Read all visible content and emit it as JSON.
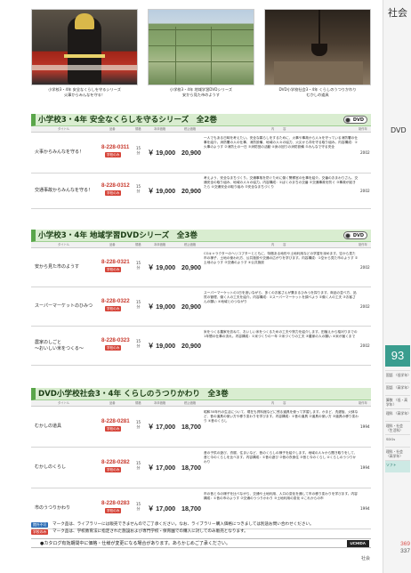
{
  "photos": [
    {
      "caption": "小学校3・4年 安全なくらしを守るシリーズ\n火事からみんなを守る！"
    },
    {
      "caption": "小学校3・4年 地域学習DVDシリーズ\n安から見た市のようす"
    },
    {
      "caption": "DVD小学校社会3・4年 くらしのうつりかわり\nむかしの道具"
    }
  ],
  "index": {
    "category": "社会",
    "dvd": "DVD",
    "page_number": "93",
    "subcategories": [
      {
        "label": "国語\n〈低学年〉"
      },
      {
        "label": "国語\n〈高学年〉"
      },
      {
        "label": "算数\n〈低・高学年〉"
      },
      {
        "label": "理科\n〈高学年〉"
      },
      {
        "label": "理科・社会\n〈生活科〉"
      },
      {
        "label": "SDGs"
      },
      {
        "label": "理科・社会\n〈高学年〉"
      },
      {
        "label": "ソフト"
      }
    ],
    "total_label": "369",
    "total2_label": "337"
  },
  "series": [
    {
      "title": "小学校3・4年 安全なくらしを守るシリーズ　全2巻",
      "dvd_label": "DVD",
      "columns": [
        "タイトル",
        "品番",
        "規格",
        "本体価格",
        "税込価格",
        "内　　　容",
        "制作年"
      ],
      "rows": [
        {
          "title": "火事からみんなを守る！",
          "code": "8-228-0311",
          "badge": "学校のみ",
          "disks": "15\n分",
          "price1": "￥ 19,000",
          "price2": "20,900",
          "desc": "一人でもある日時を考えたい。安全な暮らしをするために、火事や事故から人々を守っている消防署の仕事を紹介。消防署の人の仕事、消防設備、地域の人々の協力、火災から命を守る取り組み。内容構成：①火事のようす ②消防士の一日 ③消防団の活動 ④身の回りの消防設備 ⑤みんなで守る安全",
          "year": "2002"
        },
        {
          "title": "交通事故からみんなを守る！",
          "code": "8-228-0312",
          "badge": "学校のみ",
          "disks": "15\n分",
          "price1": "￥ 19,000",
          "price2": "20,900",
          "desc": "考えよう、安全なまちづくり。交通事故を防ぐために働く警察官の仕事を紹介。交番のおまわりさん、交通安全の取り組み、地域の人々の協力。内容構成：①ぼくのまちの交番 ②交通事故を防ぐ ③事故が起きたら ④交通安全の取り組み ⑤安全なまちづくり",
          "year": "2002"
        }
      ]
    },
    {
      "title": "小学校3・4年 地域学習DVDシリーズ　全3巻",
      "dvd_label": "DVD",
      "columns": [
        "タイトル",
        "品番",
        "規格",
        "本体価格",
        "税込価格",
        "内　　　容",
        "制作年"
      ],
      "rows": [
        {
          "title": "安から見た市のようす",
          "code": "8-228-0321",
          "badge": "学校のみ",
          "disks": "15\n分",
          "price1": "￥ 19,000",
          "price2": "20,900",
          "desc": "CGキャラクターのヘリコプターとともに、特徴ある地形や土地利用などの学習を深めます。空から見た市の様子、土地の使われ方、公共施設や交通の広がりを学びます。内容構成：①空から見た市のようす ②土地のようす ③交通のようす ④公共施設",
          "year": "2002"
        },
        {
          "title": "スーパーマーケットのひみつ",
          "code": "8-228-0322",
          "badge": "学校のみ",
          "disks": "15\n分",
          "price1": "￥ 19,000",
          "price2": "20,900",
          "desc": "スーパーマーケットの1日を追いながら、多くのお客さんが集まるひみつを探ります。商品の並べ方、品質の管理、働く人の工夫を紹介。内容構成：①スーパーマーケットを調べよう ②働く人の工夫 ③お客さんの願い ④地域とのつながり",
          "year": "2002"
        },
        {
          "title": "農家のしごと\n〜おいしい米をつくる〜",
          "code": "8-228-0323",
          "badge": "学校のみ",
          "disks": "15\n分",
          "price1": "￥ 19,000",
          "price2": "20,900",
          "desc": "米をつくる農家を訪ねて、おいしい米をつくるための工夫や努力を紹介します。田植えから稲刈りまでの1年間の仕事の流れ。内容構成：①米づくりの一年 ②米づくりの工夫 ③農家の人の願い ④米が届くまで",
          "year": "2002"
        }
      ]
    },
    {
      "title": "DVD小学校社会3・4年 くらしのうつりかわり　全3巻",
      "dvd_label": "DVD",
      "columns": [
        "タイトル",
        "品番",
        "規格",
        "本体価格",
        "税込価格",
        "内　　　容",
        "制作年"
      ],
      "rows": [
        {
          "title": "むかしの道具",
          "code": "8-228-0281",
          "badge": "学校のみ",
          "disks": "15\n分",
          "price1": "￥ 17,000",
          "price2": "18,700",
          "desc": "昭和30年代の生活について、現在も資料館などに残る道具を使って学習します。かまど、洗濯板、火鉢など、昔の道具の使い方や移り変わりを学びます。内容構成：①昔の道具 ②道具の使い方 ③道具の移り変わり ④昔のくらし",
          "year": "1994"
        },
        {
          "title": "むかしのくらし",
          "code": "8-228-0282",
          "badge": "学校のみ",
          "disks": "15\n分",
          "price1": "￥ 17,000",
          "price2": "18,700",
          "desc": "昔の子供の遊び、衣服、住まいなど、昔のくらしの様子を紹介します。地域の人々から聞き取りをして、昔と今のくらしを比べます。内容構成：①昔の遊び ②昔の衣食住 ③昔と今のくらし ④くらしのうつりかわり",
          "year": "1994"
        },
        {
          "title": "市のうつりかわり",
          "code": "8-228-0283",
          "badge": "学校のみ",
          "disks": "15\n分",
          "price1": "￥ 17,000",
          "price2": "18,700",
          "desc": "市の昔と今の様子を比べながら、交通や土地利用、人口の変化を通して市の移り変わりを学びます。内容構成：①昔の市のようす ②交通のうつりかわり ③土地利用の変化 ④これからの市",
          "year": "1994"
        }
      ]
    }
  ],
  "notes": [
    {
      "chip": "館外不可",
      "text": "マーク品は、ライブラリーには販売できませんのでご了承ください。なお、ライブラリー購入価格につきましては別途お問い合わせください。"
    },
    {
      "chip": "学校のみ",
      "text": "マーク品は、学校教育法に指定された施設および専門学校・保育園での購入に対してのみ販売となります。"
    }
  ],
  "caution": "●カタログ有効期間中に価格・仕様が変更になる場合があります。あらかじめご了承ください。",
  "brand": "UCHIDA",
  "footer": "社会"
}
